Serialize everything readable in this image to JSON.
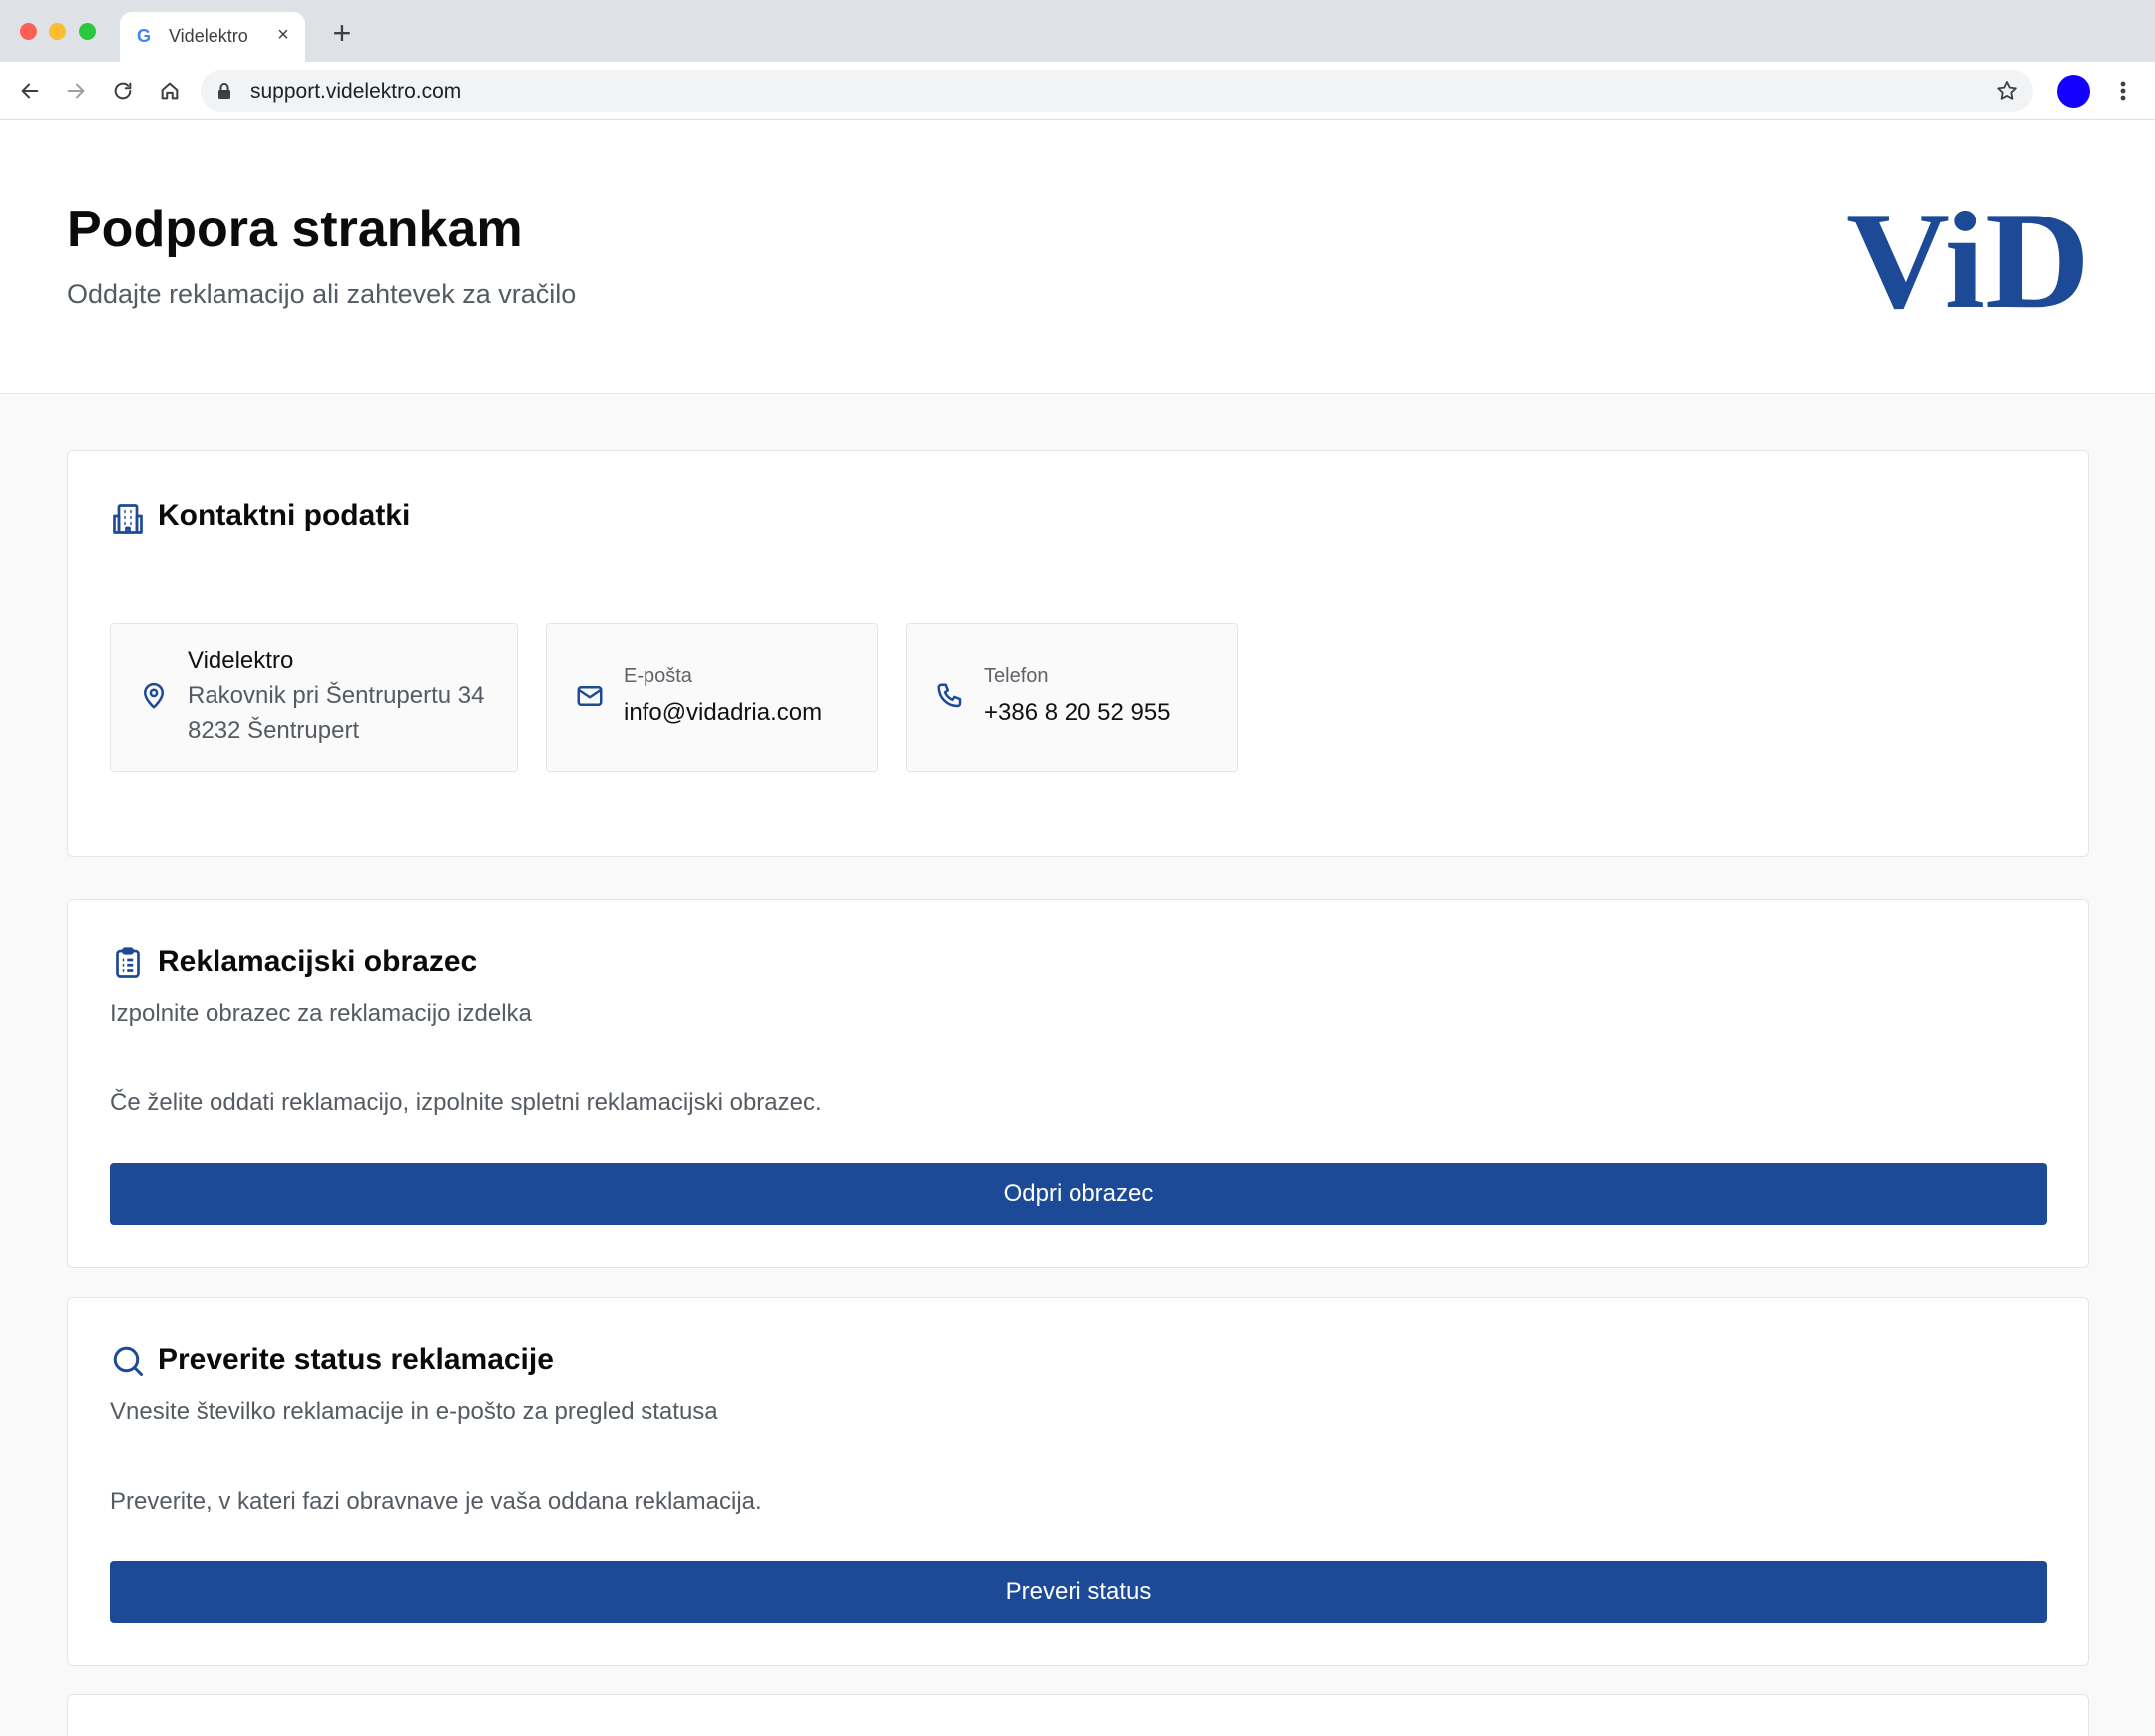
{
  "browser": {
    "tab_title": "Videlektro",
    "favicon": "G",
    "close_glyph": "×",
    "new_tab_glyph": "+",
    "url": "support.videlektro.com",
    "avatar_color": "#1300ff"
  },
  "header": {
    "title": "Podpora strankam",
    "subtitle": "Oddajte reklamacijo ali zahtevek za vračilo",
    "logo_text": "ViD",
    "logo_color": "#1c4a97"
  },
  "contact": {
    "title": "Kontaktni podatki",
    "icon": "building-icon",
    "address": {
      "name": "Videlektro",
      "line1": "Rakovnik pri Šentrupertu 34",
      "line2": "8232 Šentrupert",
      "icon": "map-pin-icon"
    },
    "email": {
      "label": "E-pošta",
      "value": "info@vidadria.com",
      "icon": "mail-icon"
    },
    "phone": {
      "label": "Telefon",
      "value": "+386 8 20 52 955",
      "icon": "phone-icon"
    }
  },
  "complaint_form": {
    "title": "Reklamacijski obrazec",
    "icon": "clipboard-list-icon",
    "subtitle": "Izpolnite obrazec za reklamacijo izdelka",
    "text": "Če želite oddati reklamacijo, izpolnite spletni reklamacijski obrazec.",
    "button_label": "Odpri obrazec"
  },
  "status_check": {
    "title": "Preverite status reklamacije",
    "icon": "search-icon",
    "subtitle": "Vnesite številko reklamacije in e-pošto za pregled statusa",
    "text": "Preverite, v kateri fazi obravnave je vaša oddana reklamacija.",
    "button_label": "Preveri status"
  },
  "colors": {
    "primary": "#1c4a97",
    "icon": "#1c4a97"
  }
}
